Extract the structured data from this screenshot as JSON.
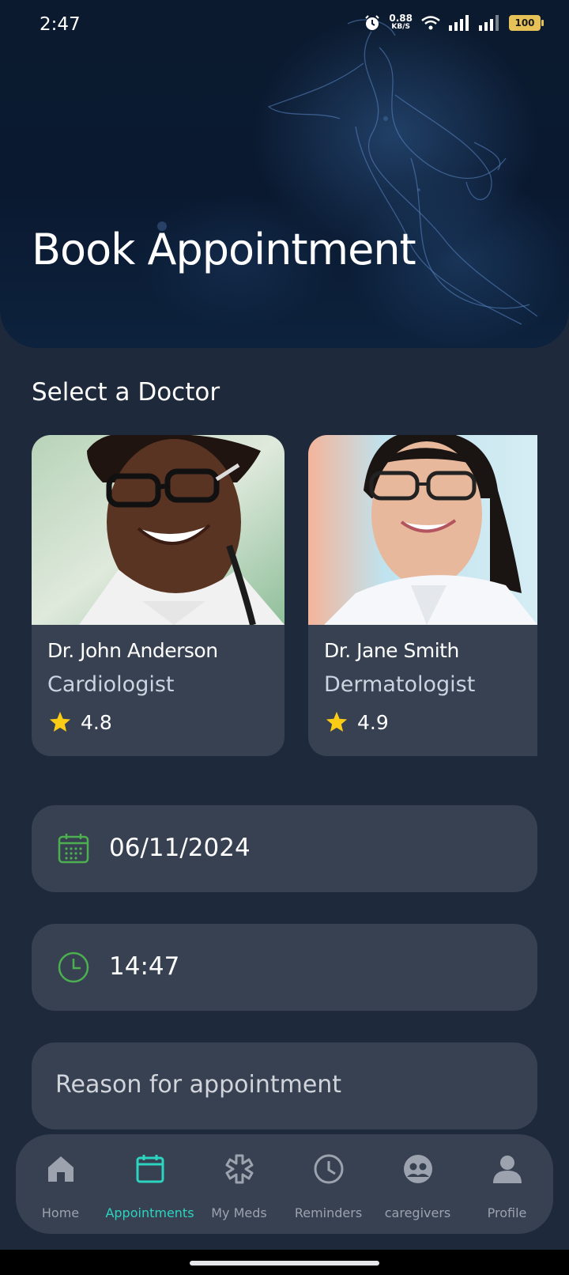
{
  "status_bar": {
    "time": "2:47",
    "net_speed_value": "0.88",
    "net_speed_unit": "KB/S",
    "battery": "100"
  },
  "header": {
    "title": "Book Appointment"
  },
  "doctors": {
    "section_title": "Select a Doctor",
    "items": [
      {
        "name": "Dr. John Anderson",
        "specialty": "Cardiologist",
        "rating": "4.8"
      },
      {
        "name": "Dr. Jane Smith",
        "specialty": "Dermatologist",
        "rating": "4.9"
      }
    ]
  },
  "form": {
    "date": "06/11/2024",
    "time": "14:47",
    "reason_placeholder": "Reason for appointment"
  },
  "nav": {
    "items": [
      {
        "label": "Home",
        "icon": "home-icon"
      },
      {
        "label": "Appointments",
        "icon": "calendar-icon"
      },
      {
        "label": "My Meds",
        "icon": "medical-star-icon"
      },
      {
        "label": "Reminders",
        "icon": "clock-icon"
      },
      {
        "label": "caregivers",
        "icon": "caregivers-icon"
      },
      {
        "label": "Profile",
        "icon": "person-icon"
      }
    ],
    "active_index": 1
  },
  "colors": {
    "background": "#1e293b",
    "card": "#374151",
    "accent": "#2dd4bf",
    "icon_green": "#4caf50",
    "star": "#facc15"
  }
}
